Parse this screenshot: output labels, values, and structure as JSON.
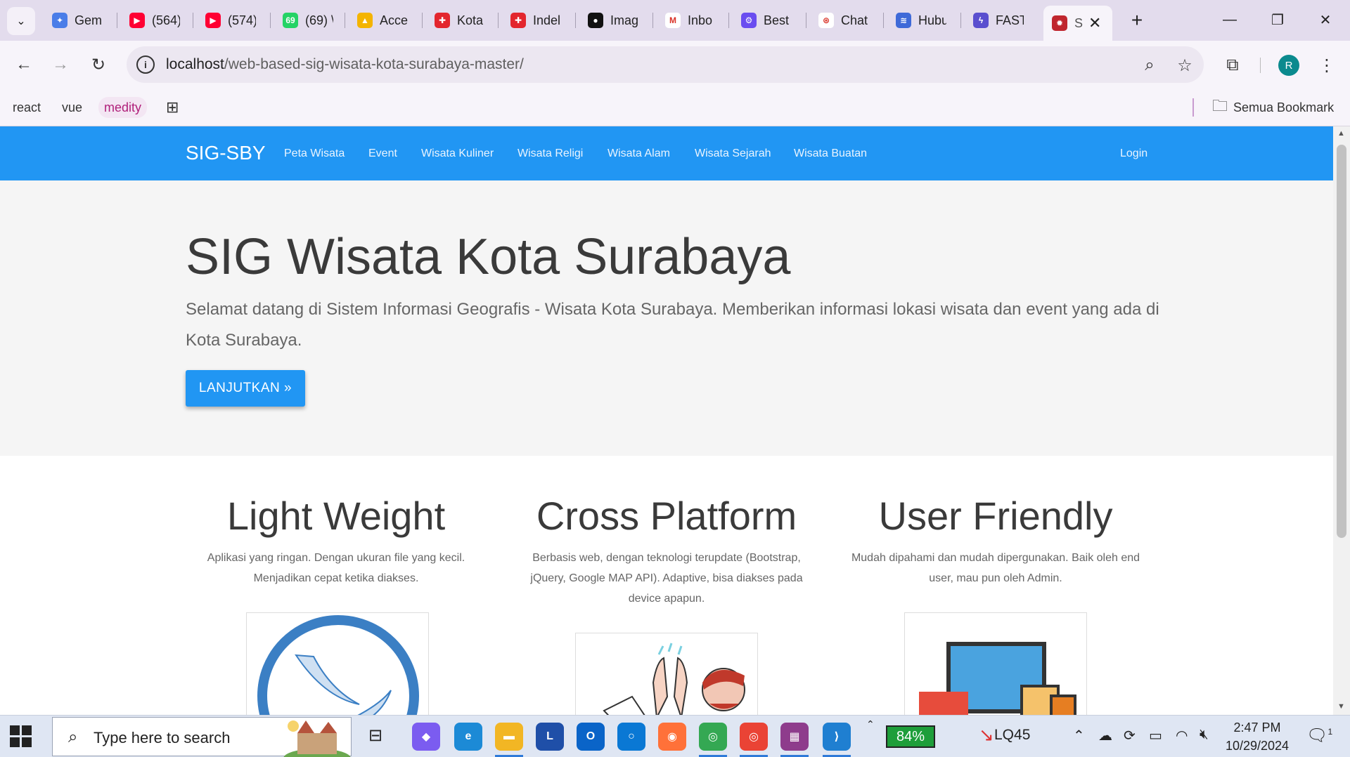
{
  "browser": {
    "tabs": [
      {
        "label": "Gem",
        "icon": "gemini-icon",
        "color": "#4a7de8",
        "glyph": "✦"
      },
      {
        "label": "(564)",
        "icon": "youtube-icon",
        "color": "#ff0033",
        "glyph": "▶"
      },
      {
        "label": "(574)",
        "icon": "youtube-icon",
        "color": "#ff0033",
        "glyph": "▶"
      },
      {
        "label": "(69) \\",
        "icon": "whatsapp-icon",
        "color": "#25d366",
        "glyph": "69"
      },
      {
        "label": "Acce",
        "icon": "google-drive-icon",
        "color": "#f4b400",
        "glyph": "▲"
      },
      {
        "label": "Kota",
        "icon": "red-cross-icon",
        "color": "#e3262e",
        "glyph": "✚"
      },
      {
        "label": "Indel",
        "icon": "red-cross-icon",
        "color": "#e3262e",
        "glyph": "✚"
      },
      {
        "label": "Imag",
        "icon": "dark-circle-icon",
        "color": "#111111",
        "glyph": "●"
      },
      {
        "label": "Inbo",
        "icon": "gmail-icon",
        "color": "#ffffff",
        "glyph": "M"
      },
      {
        "label": "Best",
        "icon": "gear-purple-icon",
        "color": "#6a4df0",
        "glyph": "⚙"
      },
      {
        "label": "Chat",
        "icon": "chatgpt-icon",
        "color": "#ffffff",
        "glyph": "⊛"
      },
      {
        "label": "Hubu",
        "icon": "stack-icon",
        "color": "#3f6ad8",
        "glyph": "≋"
      },
      {
        "label": "FAST",
        "icon": "fastapi-icon",
        "color": "#5a4fcf",
        "glyph": "ϟ"
      }
    ],
    "active_tab": {
      "label": "S",
      "icon": "site-favicon-icon",
      "color": "#c0262e"
    },
    "url_host": "localhost",
    "url_path": "/web-based-sig-wisata-kota-surabaya-master/",
    "profile_initial": "R",
    "bookmarks": [
      "react",
      "vue",
      "medity"
    ],
    "all_bookmarks_label": "Semua Bookmark"
  },
  "site": {
    "brand": "SIG-SBY",
    "nav": [
      "Peta Wisata",
      "Event",
      "Wisata Kuliner",
      "Wisata Religi",
      "Wisata Alam",
      "Wisata Sejarah",
      "Wisata Buatan"
    ],
    "login": "Login",
    "hero_title": "SIG Wisata Kota Surabaya",
    "hero_text": "Selamat datang di Sistem Informasi Geografis - Wisata Kota Surabaya. Memberikan informasi lokasi wisata dan event yang ada di Kota Surabaya.",
    "hero_button": "LANJUTKAN »",
    "features": [
      {
        "title": "Light Weight",
        "text": "Aplikasi yang ringan. Dengan ukuran file yang kecil. Menjadikan cepat ketika diakses."
      },
      {
        "title": "Cross Platform",
        "text": "Berbasis web, dengan teknologi terupdate (Bootstrap, jQuery, Google MAP API). Adaptive, bisa diakses pada device apapun."
      },
      {
        "title": "User Friendly",
        "text": "Mudah dipahami dan mudah dipergunakan. Baik oleh end user, mau pun oleh Admin."
      }
    ],
    "accent_color": "#2196f3"
  },
  "taskbar": {
    "search_placeholder": "Type here to search",
    "battery_percent": "84%",
    "stock_label": "LQ45",
    "time": "2:47 PM",
    "date": "10/29/2024",
    "notification_count": "1"
  }
}
